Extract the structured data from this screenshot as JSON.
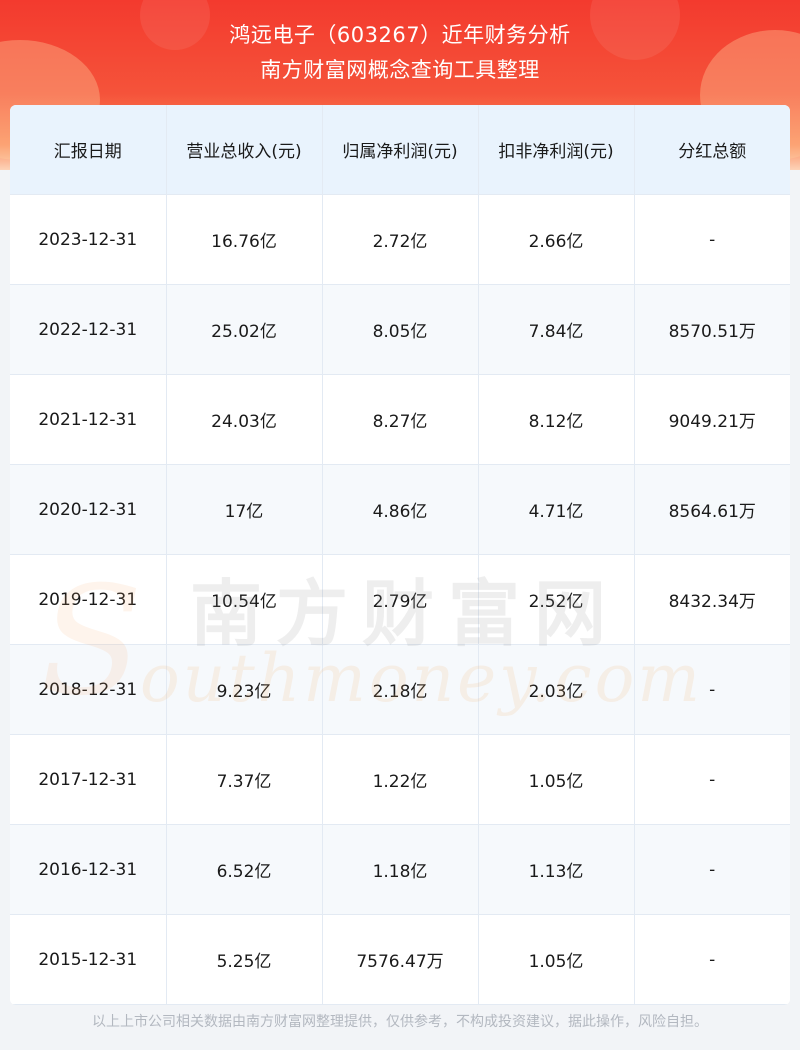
{
  "header": {
    "title_line1": "鸿远电子（603267）近年财务分析",
    "title_line2": "南方财富网概念查询工具整理"
  },
  "table": {
    "columns": [
      "汇报日期",
      "营业总收入(元)",
      "归属净利润(元)",
      "扣非净利润(元)",
      "分红总额"
    ],
    "rows": [
      [
        "2023-12-31",
        "16.76亿",
        "2.72亿",
        "2.66亿",
        "-"
      ],
      [
        "2022-12-31",
        "25.02亿",
        "8.05亿",
        "7.84亿",
        "8570.51万"
      ],
      [
        "2021-12-31",
        "24.03亿",
        "8.27亿",
        "8.12亿",
        "9049.21万"
      ],
      [
        "2020-12-31",
        "17亿",
        "4.86亿",
        "4.71亿",
        "8564.61万"
      ],
      [
        "2019-12-31",
        "10.54亿",
        "2.79亿",
        "2.52亿",
        "8432.34万"
      ],
      [
        "2018-12-31",
        "9.23亿",
        "2.18亿",
        "2.03亿",
        "-"
      ],
      [
        "2017-12-31",
        "7.37亿",
        "1.22亿",
        "1.05亿",
        "-"
      ],
      [
        "2016-12-31",
        "6.52亿",
        "1.18亿",
        "1.13亿",
        "-"
      ],
      [
        "2015-12-31",
        "5.25亿",
        "7576.47万",
        "1.05亿",
        "-"
      ]
    ]
  },
  "watermark": {
    "cn": "南方财富网",
    "en": "outhmoney.com",
    "s": "S"
  },
  "footer": {
    "disclaimer": "以上上市公司相关数据由南方财富网整理提供，仅供参考，不构成投资建议，据此操作，风险自担。"
  },
  "colors": {
    "header_red": "#f33a2e",
    "table_header_bg": "#e9f3fd",
    "row_alt_bg": "#f6f9fc",
    "footer_text": "#b3b8c0"
  }
}
